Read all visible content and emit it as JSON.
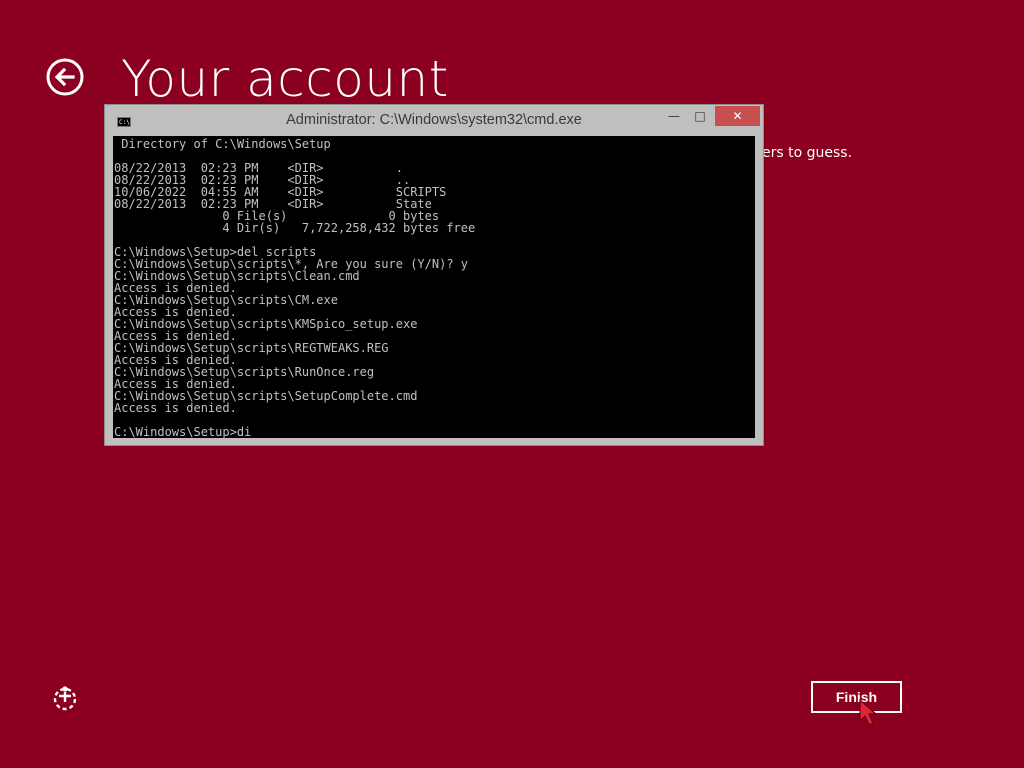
{
  "page": {
    "title": "Your account",
    "hint_text": "ers to guess.",
    "finish_label": "Finish"
  },
  "colors": {
    "background": "#8b0020",
    "window_chrome": "#bfbfbf",
    "close_button": "#c74f4f",
    "console_bg": "#000000",
    "console_text": "#c0c0c0"
  },
  "icons": {
    "back": "back-arrow-circle-icon",
    "ease_of_access": "ease-of-access-icon",
    "console_app": "cmd-app-icon",
    "cursor": "mouse-pointer-icon"
  },
  "cmd": {
    "title": "Administrator: C:\\Windows\\system32\\cmd.exe",
    "app_icon_text": "C:\\",
    "minimize_label": "—",
    "maximize_label": "□",
    "close_label": "✕",
    "lines": [
      " Directory of C:\\Windows\\Setup",
      "",
      "08/22/2013  02:23 PM    <DIR>          .",
      "08/22/2013  02:23 PM    <DIR>          ..",
      "10/06/2022  04:55 AM    <DIR>          SCRIPTS",
      "08/22/2013  02:23 PM    <DIR>          State",
      "               0 File(s)              0 bytes",
      "               4 Dir(s)   7,722,258,432 bytes free",
      "",
      "C:\\Windows\\Setup>del scripts",
      "C:\\Windows\\Setup\\scripts\\*, Are you sure (Y/N)? y",
      "C:\\Windows\\Setup\\scripts\\Clean.cmd",
      "Access is denied.",
      "C:\\Windows\\Setup\\scripts\\CM.exe",
      "Access is denied.",
      "C:\\Windows\\Setup\\scripts\\KMSpico_setup.exe",
      "Access is denied.",
      "C:\\Windows\\Setup\\scripts\\REGTWEAKS.REG",
      "Access is denied.",
      "C:\\Windows\\Setup\\scripts\\RunOnce.reg",
      "Access is denied.",
      "C:\\Windows\\Setup\\scripts\\SetupComplete.cmd",
      "Access is denied.",
      "",
      "C:\\Windows\\Setup>di"
    ]
  }
}
